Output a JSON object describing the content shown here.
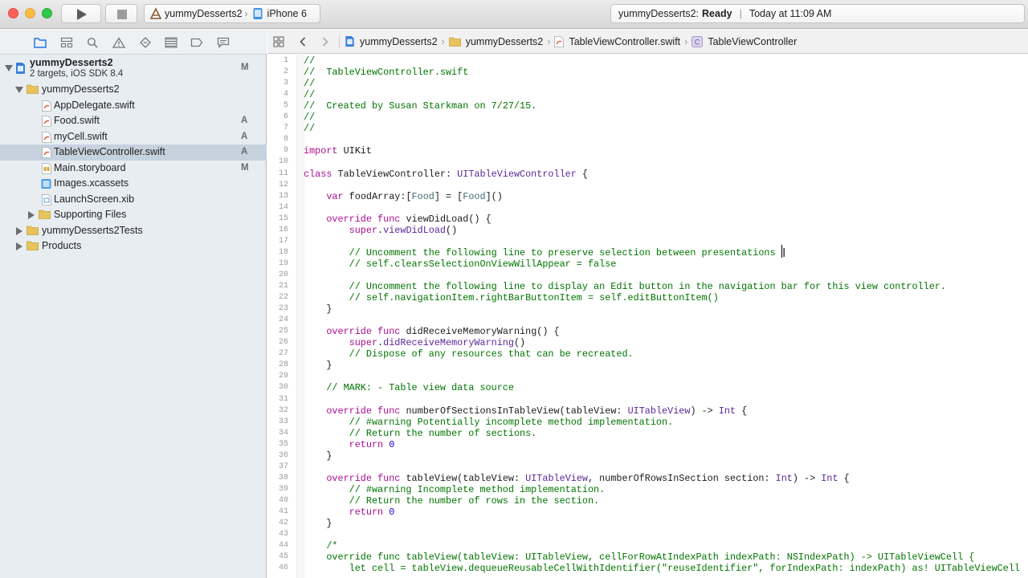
{
  "toolbar": {
    "scheme_name": "yummyDesserts2",
    "destination": "iPhone 6",
    "activity_project": "yummyDesserts2:",
    "activity_status": "Ready",
    "activity_time": "Today at 11:09 AM"
  },
  "navigator": {
    "project": {
      "name": "yummyDesserts2",
      "subtitle": "2 targets, iOS SDK 8.4",
      "badge": "M"
    },
    "items": [
      {
        "label": "yummyDesserts2",
        "badge": ""
      },
      {
        "label": "AppDelegate.swift",
        "badge": ""
      },
      {
        "label": "Food.swift",
        "badge": "A"
      },
      {
        "label": "myCell.swift",
        "badge": "A"
      },
      {
        "label": "TableViewController.swift",
        "badge": "A"
      },
      {
        "label": "Main.storyboard",
        "badge": "M"
      },
      {
        "label": "Images.xcassets",
        "badge": ""
      },
      {
        "label": "LaunchScreen.xib",
        "badge": ""
      },
      {
        "label": "Supporting Files",
        "badge": ""
      },
      {
        "label": "yummyDesserts2Tests",
        "badge": ""
      },
      {
        "label": "Products",
        "badge": ""
      }
    ]
  },
  "jumpbar": {
    "crumbs": [
      "yummyDesserts2",
      "yummyDesserts2",
      "TableViewController.swift",
      "TableViewController"
    ]
  },
  "editor": {
    "lines": [
      {
        "n": "1",
        "segs": [
          [
            "c",
            "//"
          ]
        ]
      },
      {
        "n": "2",
        "segs": [
          [
            "c",
            "//  TableViewController.swift"
          ]
        ]
      },
      {
        "n": "3",
        "segs": [
          [
            "c",
            "//"
          ]
        ]
      },
      {
        "n": "4",
        "segs": [
          [
            "c",
            "//"
          ]
        ]
      },
      {
        "n": "5",
        "segs": [
          [
            "c",
            "//  Created by Susan Starkman on 7/27/15."
          ]
        ]
      },
      {
        "n": "6",
        "segs": [
          [
            "c",
            "//"
          ]
        ]
      },
      {
        "n": "7",
        "segs": [
          [
            "c",
            "//"
          ]
        ]
      },
      {
        "n": "8",
        "segs": []
      },
      {
        "n": "9",
        "segs": [
          [
            "k",
            "import"
          ],
          [
            "",
            " UIKit"
          ]
        ]
      },
      {
        "n": "10",
        "segs": []
      },
      {
        "n": "11",
        "segs": [
          [
            "k",
            "class"
          ],
          [
            "",
            " TableViewController: "
          ],
          [
            "t",
            "UITableViewController"
          ],
          [
            "",
            " {"
          ]
        ]
      },
      {
        "n": "12",
        "segs": []
      },
      {
        "n": "13",
        "segs": [
          [
            "",
            "    "
          ],
          [
            "k",
            "var"
          ],
          [
            "",
            " foodArray:["
          ],
          [
            "p",
            "Food"
          ],
          [
            "",
            "] = ["
          ],
          [
            "p",
            "Food"
          ],
          [
            "",
            "]()"
          ]
        ]
      },
      {
        "n": "14",
        "segs": []
      },
      {
        "n": "15",
        "segs": [
          [
            "",
            "    "
          ],
          [
            "k",
            "override"
          ],
          [
            "",
            " "
          ],
          [
            "k",
            "func"
          ],
          [
            "",
            " viewDidLoad() {"
          ]
        ]
      },
      {
        "n": "16",
        "segs": [
          [
            "",
            "        "
          ],
          [
            "k",
            "super"
          ],
          [
            "",
            "."
          ],
          [
            "t",
            "viewDidLoad"
          ],
          [
            "",
            "()"
          ]
        ]
      },
      {
        "n": "17",
        "segs": []
      },
      {
        "n": "18",
        "segs": [
          [
            "",
            "        "
          ],
          [
            "c",
            "// Uncomment the following line to preserve selection between presentations"
          ]
        ]
      },
      {
        "n": "19",
        "segs": [
          [
            "",
            "        "
          ],
          [
            "c",
            "// self.clearsSelectionOnViewWillAppear = false"
          ]
        ]
      },
      {
        "n": "20",
        "segs": []
      },
      {
        "n": "21",
        "segs": [
          [
            "",
            "        "
          ],
          [
            "c",
            "// Uncomment the following line to display an Edit button in the navigation bar for this view controller."
          ]
        ]
      },
      {
        "n": "22",
        "segs": [
          [
            "",
            "        "
          ],
          [
            "c",
            "// self.navigationItem.rightBarButtonItem = self.editButtonItem()"
          ]
        ]
      },
      {
        "n": "23",
        "segs": [
          [
            "",
            "    }"
          ]
        ]
      },
      {
        "n": "24",
        "segs": []
      },
      {
        "n": "25",
        "segs": [
          [
            "",
            "    "
          ],
          [
            "k",
            "override"
          ],
          [
            "",
            " "
          ],
          [
            "k",
            "func"
          ],
          [
            "",
            " didReceiveMemoryWarning() {"
          ]
        ]
      },
      {
        "n": "26",
        "segs": [
          [
            "",
            "        "
          ],
          [
            "k",
            "super"
          ],
          [
            "",
            "."
          ],
          [
            "t",
            "didReceiveMemoryWarning"
          ],
          [
            "",
            "()"
          ]
        ]
      },
      {
        "n": "27",
        "segs": [
          [
            "",
            "        "
          ],
          [
            "c",
            "// Dispose of any resources that can be recreated."
          ]
        ]
      },
      {
        "n": "28",
        "segs": [
          [
            "",
            "    }"
          ]
        ]
      },
      {
        "n": "29",
        "segs": []
      },
      {
        "n": "30",
        "segs": [
          [
            "",
            "    "
          ],
          [
            "c",
            "// MARK: - Table view data source"
          ]
        ]
      },
      {
        "n": "31",
        "segs": []
      },
      {
        "n": "32",
        "segs": [
          [
            "",
            "    "
          ],
          [
            "k",
            "override"
          ],
          [
            "",
            " "
          ],
          [
            "k",
            "func"
          ],
          [
            "",
            " numberOfSectionsInTableView(tableView: "
          ],
          [
            "t",
            "UITableView"
          ],
          [
            "",
            ") -> "
          ],
          [
            "t",
            "Int"
          ],
          [
            "",
            " {"
          ]
        ]
      },
      {
        "n": "33",
        "segs": [
          [
            "",
            "        "
          ],
          [
            "c",
            "// #warning Potentially incomplete method implementation."
          ]
        ]
      },
      {
        "n": "34",
        "segs": [
          [
            "",
            "        "
          ],
          [
            "c",
            "// Return the number of sections."
          ]
        ]
      },
      {
        "n": "35",
        "segs": [
          [
            "",
            "        "
          ],
          [
            "k",
            "return"
          ],
          [
            "",
            " "
          ],
          [
            "n",
            "0"
          ]
        ]
      },
      {
        "n": "36",
        "segs": [
          [
            "",
            "    }"
          ]
        ]
      },
      {
        "n": "37",
        "segs": []
      },
      {
        "n": "38",
        "segs": [
          [
            "",
            "    "
          ],
          [
            "k",
            "override"
          ],
          [
            "",
            " "
          ],
          [
            "k",
            "func"
          ],
          [
            "",
            " tableView(tableView: "
          ],
          [
            "t",
            "UITableView"
          ],
          [
            "",
            ", numberOfRowsInSection section: "
          ],
          [
            "t",
            "Int"
          ],
          [
            "",
            ") -> "
          ],
          [
            "t",
            "Int"
          ],
          [
            "",
            " {"
          ]
        ]
      },
      {
        "n": "39",
        "segs": [
          [
            "",
            "        "
          ],
          [
            "c",
            "// #warning Incomplete method implementation."
          ]
        ]
      },
      {
        "n": "40",
        "segs": [
          [
            "",
            "        "
          ],
          [
            "c",
            "// Return the number of rows in the section."
          ]
        ]
      },
      {
        "n": "41",
        "segs": [
          [
            "",
            "        "
          ],
          [
            "k",
            "return"
          ],
          [
            "",
            " "
          ],
          [
            "n",
            "0"
          ]
        ]
      },
      {
        "n": "42",
        "segs": [
          [
            "",
            "    }"
          ]
        ]
      },
      {
        "n": "43",
        "segs": []
      },
      {
        "n": "44",
        "segs": [
          [
            "",
            "    "
          ],
          [
            "c",
            "/*"
          ]
        ]
      },
      {
        "n": "45",
        "segs": [
          [
            "",
            "    "
          ],
          [
            "c",
            "override func tableView(tableView: UITableView, cellForRowAtIndexPath indexPath: NSIndexPath) -> UITableViewCell {"
          ]
        ]
      },
      {
        "n": "46",
        "segs": [
          [
            "",
            "        "
          ],
          [
            "c",
            "let cell = tableView.dequeueReusableCellWithIdentifier(\"reuseIdentifier\", forIndexPath: indexPath) as! UITableViewCell"
          ]
        ]
      }
    ]
  }
}
